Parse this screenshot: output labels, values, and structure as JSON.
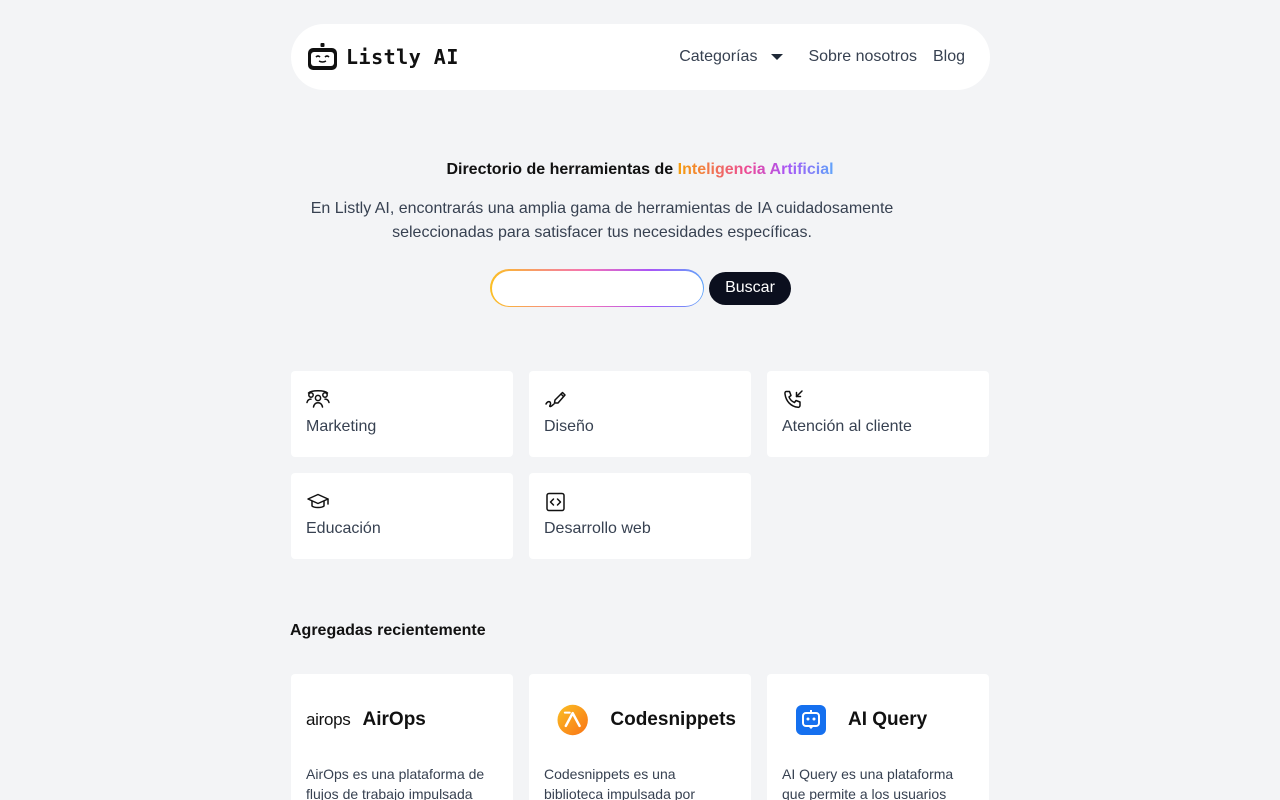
{
  "brand": {
    "name": "Listly AI"
  },
  "nav": {
    "categories_label": "Categorías",
    "about_label": "Sobre nosotros",
    "blog_label": "Blog"
  },
  "hero": {
    "title_prefix": "Directorio de herramientas de",
    "title_highlight": "Inteligencia Artificial",
    "description": "En Listly AI, encontrarás una amplia gama de herramientas de IA cuidadosamente seleccionadas para satisfacer tus necesidades específicas.",
    "search_placeholder": "",
    "search_button": "Buscar"
  },
  "categories": [
    {
      "label": "Marketing",
      "icon": "people-group-icon"
    },
    {
      "label": "Diseño",
      "icon": "pen-icon"
    },
    {
      "label": "Atención al cliente",
      "icon": "phone-incoming-icon"
    },
    {
      "label": "Educación",
      "icon": "graduation-cap-icon"
    },
    {
      "label": "Desarrollo web",
      "icon": "code-icon"
    }
  ],
  "recent": {
    "title": "Agregadas recientemente",
    "tools": [
      {
        "name": "AirOps",
        "logo_text": "airops",
        "description": "AirOps es una plataforma de flujos de trabajo impulsada"
      },
      {
        "name": "Codesnippets",
        "logo": "codesnippets-logo-icon",
        "description": "Codesnippets es una biblioteca impulsada por"
      },
      {
        "name": "AI Query",
        "logo": "ai-query-logo-icon",
        "description": "AI Query es una plataforma que permite a los usuarios"
      }
    ]
  },
  "colors": {
    "background": "#f3f4f6",
    "button_dark": "#0b0f1e",
    "gradient": [
      "#f59e0b",
      "#ec4899",
      "#a855f7",
      "#60a5fa"
    ]
  }
}
